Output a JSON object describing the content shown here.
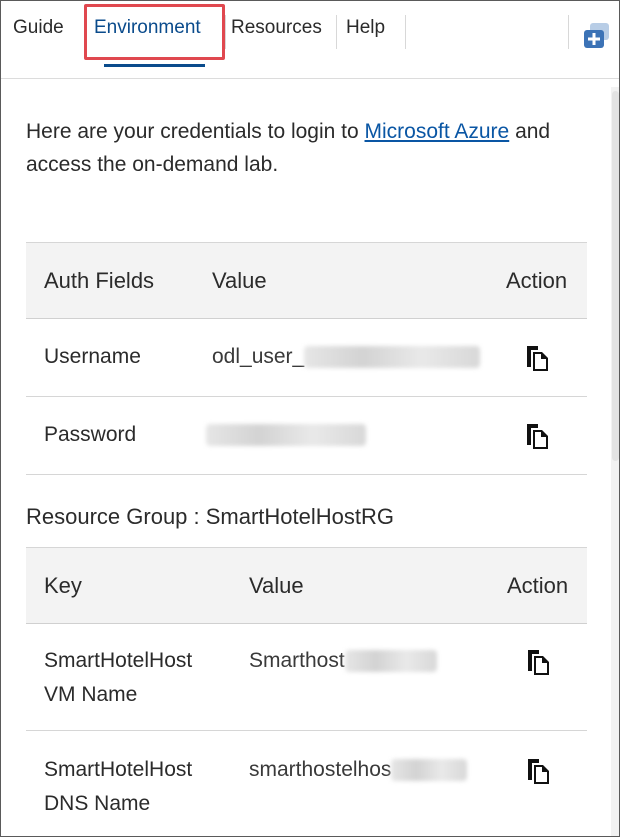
{
  "tabs": {
    "guide": "Guide",
    "environment": "Environment",
    "resources": "Resources",
    "help": "Help"
  },
  "intro": {
    "text_before": "Here are your credentials to login to ",
    "link": "Microsoft Azure",
    "text_after": " and access the on-demand lab."
  },
  "credentials": {
    "headers": {
      "field": "Auth Fields",
      "value": "Value",
      "action": "Action"
    },
    "rows": [
      {
        "label": "Username",
        "value_prefix": "odl_user_"
      },
      {
        "label": "Password",
        "value_prefix": ""
      }
    ]
  },
  "resource_group": {
    "title": "Resource Group : SmartHotelHostRG",
    "headers": {
      "key": "Key",
      "value": "Value",
      "action": "Action"
    },
    "rows": [
      {
        "key_line1": "SmartHotelHost",
        "key_line2": "VM Name",
        "value_prefix": "Smarthost"
      },
      {
        "key_line1": "SmartHotelHost",
        "key_line2": "DNS Name",
        "value_prefix": "smarthostelhos"
      }
    ]
  },
  "colors": {
    "active_tab": "#0a4b8c",
    "highlight_border": "#e0484f",
    "link": "#0a56a4",
    "header_bg": "#f3f3f3"
  },
  "icons": {
    "copy": "copy-icon",
    "panel": "panel-add-icon"
  }
}
